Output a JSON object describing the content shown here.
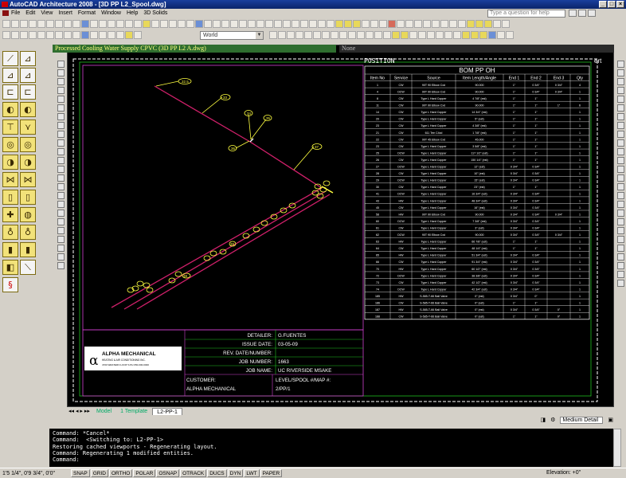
{
  "window": {
    "title": "AutoCAD Architecture 2008 - [3D PP L2_Spool.dwg]",
    "buttons": [
      "_",
      "□",
      "×"
    ]
  },
  "menu": [
    "File",
    "Edit",
    "View",
    "Insert",
    "Format",
    "Window",
    "Help",
    "3D Solids"
  ],
  "help_box": {
    "placeholder": "Type a question for help"
  },
  "toolbar": {
    "layer_combo": "World",
    "layer_combo2": "None"
  },
  "palette_titles": {
    "left": "Processed Cooling Water Supply CPVC (3D PP L2 A.dwg)",
    "right": "None"
  },
  "drawing": {
    "bom_header": "POSITION",
    "bom_title": "BOM  PP  OH",
    "bom_columns": [
      "Item No",
      "Service",
      "Source",
      "Item Length/Angle",
      "End 1",
      "End 2",
      "End 3",
      "Qty"
    ],
    "bom_rows": [
      [
        "1",
        "CW",
        "90T 90 Elbow Cxd",
        "90.000",
        "1\"",
        "0 3/4\"",
        "0 3/4\"",
        "4"
      ],
      [
        "4",
        "DCW",
        "90T 90 Elbow Cxd",
        "90.000",
        "1\"",
        "0 3/4\"",
        "0 3/4\"",
        "1"
      ],
      [
        "8",
        "CW",
        "Type L Hard Copper",
        "4 7/8\" (est)",
        "1\"",
        "1\"",
        "",
        "1"
      ],
      [
        "11",
        "CW",
        "90T 90 Elbow Cxd",
        "90.000",
        "1\"",
        "1\"",
        "1\"",
        "6"
      ],
      [
        "14",
        "CW",
        "Type L Hard Copper",
        "14 3/4\" (est)",
        "1\"",
        "1\"",
        "",
        "1"
      ],
      [
        "20",
        "CW",
        "Type L Hard Copper",
        "5\" (est)",
        "1\"",
        "1\"",
        "",
        "1"
      ],
      [
        "23",
        "CW",
        "Type L Hard Copper",
        "4 3/8\" (est)",
        "1\"",
        "1\"",
        "",
        "1"
      ],
      [
        "21",
        "CW",
        "611 Tee C4xd",
        "1 7/8\" (est)",
        "1\"",
        "1\"",
        "",
        "1"
      ],
      [
        "22",
        "CW",
        "90T 45 Elbow Cxd",
        "45.000",
        "1\"",
        "1\"",
        "",
        "1"
      ],
      [
        "23",
        "CW",
        "Type L Hard Copper",
        "3 5/8\" (est)",
        "1\"",
        "1\"",
        "",
        "1"
      ],
      [
        "25",
        "DCW",
        "Type L Hard Copper",
        "117 1/2\" (est)",
        "1\"",
        "1\"",
        "",
        "1"
      ],
      [
        "26",
        "CW",
        "Type L Hard Copper",
        "150 1/4\" (est)",
        "1\"",
        "1\"",
        "",
        "1"
      ],
      [
        "27",
        "DCW",
        "Type L Hard Copper",
        "12\" (est)",
        "0 3/4\"",
        "0 3/4\"",
        "",
        "1"
      ],
      [
        "28",
        "CW",
        "Type L Hard Copper",
        "10\" (est)",
        "0 3/4\"",
        "0 3/4\"",
        "",
        "1"
      ],
      [
        "29",
        "DCW",
        "Type L Hard Copper",
        "15\" (est)",
        "0 3/4\"",
        "0 3/4\"",
        "",
        "1"
      ],
      [
        "30",
        "CW",
        "Type L Hard Copper",
        "23\" (est)",
        "1\"",
        "1\"",
        "",
        "1"
      ],
      [
        "41",
        "DCW",
        "Type L Hard Copper",
        "16 3/4\" (est)",
        "0 3/4\"",
        "0 3/4\"",
        "",
        "1"
      ],
      [
        "43",
        "HW",
        "Type L Hard Copper",
        "48 3/4\" (est)",
        "0 3/4\"",
        "0 3/4\"",
        "",
        "1"
      ],
      [
        "45",
        "CW",
        "Type L Hard Copper",
        "16\" (est)",
        "0 3/4\"",
        "0 3/4\"",
        "",
        "1"
      ],
      [
        "58",
        "HW",
        "90T 90 Elbow Cxd",
        "90.000",
        "0 3/4\"",
        "0 3/4\"",
        "0 3/4\"",
        "1"
      ],
      [
        "60",
        "DCW",
        "Type L Hard Copper",
        "7 3/8\" (est)",
        "0 3/4\"",
        "0 3/4\"",
        "",
        "1"
      ],
      [
        "61",
        "CW",
        "Type L Hard Copper",
        "3\" (est)",
        "0 3/4\"",
        "0 3/4\"",
        "",
        "1"
      ],
      [
        "62",
        "DCW",
        "90T 90 Elbow Cxd",
        "90.000",
        "0 3/4\"",
        "0 3/4\"",
        "0 3/4\"",
        "1"
      ],
      [
        "63",
        "HW",
        "Type L Hard Copper",
        "66 7/8\" (est)",
        "1\"",
        "1\"",
        "",
        "1"
      ],
      [
        "64",
        "CW",
        "Type L Hard Copper",
        "48 1/4\" (est)",
        "1\"",
        "1\"",
        "",
        "1"
      ],
      [
        "65",
        "HW",
        "Type L Hard Copper",
        "51 3/4\" (est)",
        "0 3/4\"",
        "0 3/4\"",
        "",
        "1"
      ],
      [
        "66",
        "CW",
        "Type L Hard Copper",
        "91 3/4\" (est)",
        "0 3/4\"",
        "0 3/4\"",
        "",
        "1"
      ],
      [
        "70",
        "HW",
        "Type L Hard Copper",
        "60 1/2\" (est)",
        "0 3/4\"",
        "0 3/4\"",
        "",
        "1"
      ],
      [
        "72",
        "DCW",
        "Type L Hard Copper",
        "38 3/8\" (est)",
        "0 3/4\"",
        "0 3/4\"",
        "",
        "1"
      ],
      [
        "73",
        "CW",
        "Type L Hard Copper",
        "42 1/2\" (est)",
        "0 3/4\"",
        "0 3/4\"",
        "",
        "1"
      ],
      [
        "74",
        "DCW",
        "Type L Hard Copper",
        "42 3/4\" (est)",
        "0 3/4\"",
        "0 3/4\"",
        "",
        "1"
      ],
      [
        "185",
        "HW",
        "S-585-T-66 Ball Valve",
        "0\" (est)",
        "0 3/4\"",
        "0\"",
        "",
        "1"
      ],
      [
        "186",
        "CW",
        "S-585-T-66 Ball Valve",
        "0\" (est)",
        "1\"",
        "1\"",
        "",
        "1"
      ],
      [
        "187",
        "HW",
        "S-585-T-66 Ball Valve",
        "0\" (est)",
        "0 3/4\"",
        "0 3/4\"",
        "0\"",
        "1"
      ],
      [
        "188",
        "CW",
        "S-585-T-66 Ball Valve",
        "0\" (est)",
        "1\"",
        "1\"",
        "0\"",
        "1"
      ]
    ],
    "callouts": [
      "32.5",
      "33",
      "34",
      "35",
      "36",
      "37",
      "38",
      "39"
    ],
    "title_block": {
      "company": "ALPHA MECHANICAL",
      "company_sub": "HEATING & AIR CONDITIONING INC.",
      "company_addr": "4700 WESTERN LOOP S  PH 650-000-0000",
      "fields": [
        {
          "label": "DETAILER:",
          "value": "G.FUENTES"
        },
        {
          "label": "ISSUE DATE:",
          "value": "03-05-09"
        },
        {
          "label": "REV. DATE/NUMBER:",
          "value": ""
        },
        {
          "label": "JOB NUMBER:",
          "value": "1663"
        },
        {
          "label": "JOB NAME:",
          "value": "UC RIVERSIDE MSAKE"
        }
      ],
      "customer_label": "CUSTOMER:",
      "customer_value": "ALPHA MECHANICAL",
      "level_label": "LEVEL/SPOOL #/MAP #:",
      "level_value": "2/PP/1"
    }
  },
  "tabs": [
    "Model",
    "1 Template",
    "L2-PP-1"
  ],
  "active_tab": "L2-PP-1",
  "detail_combo": "Medium Detail",
  "command_lines": [
    "Command: *Cancel*",
    "Command:  <Switching to: L2-PP-1>",
    "Restoring cached viewports - Regenerating layout.",
    "Command: Regenerating 1 modified entities.",
    "Command:"
  ],
  "status": {
    "coords": "1'5 1/4\", 0'9 3/4\", 0'0\"",
    "buttons": [
      "SNAP",
      "GRID",
      "ORTHO",
      "POLAR",
      "OSNAP",
      "OTRACK",
      "DUCS",
      "DYN",
      "LWT",
      "PAPER"
    ],
    "elevation": "Elevation:  +0\""
  },
  "colors": {
    "pipe": "#d0206a",
    "callout": "#ffff40",
    "border": "#ffffff",
    "green_line": "#20c020"
  }
}
